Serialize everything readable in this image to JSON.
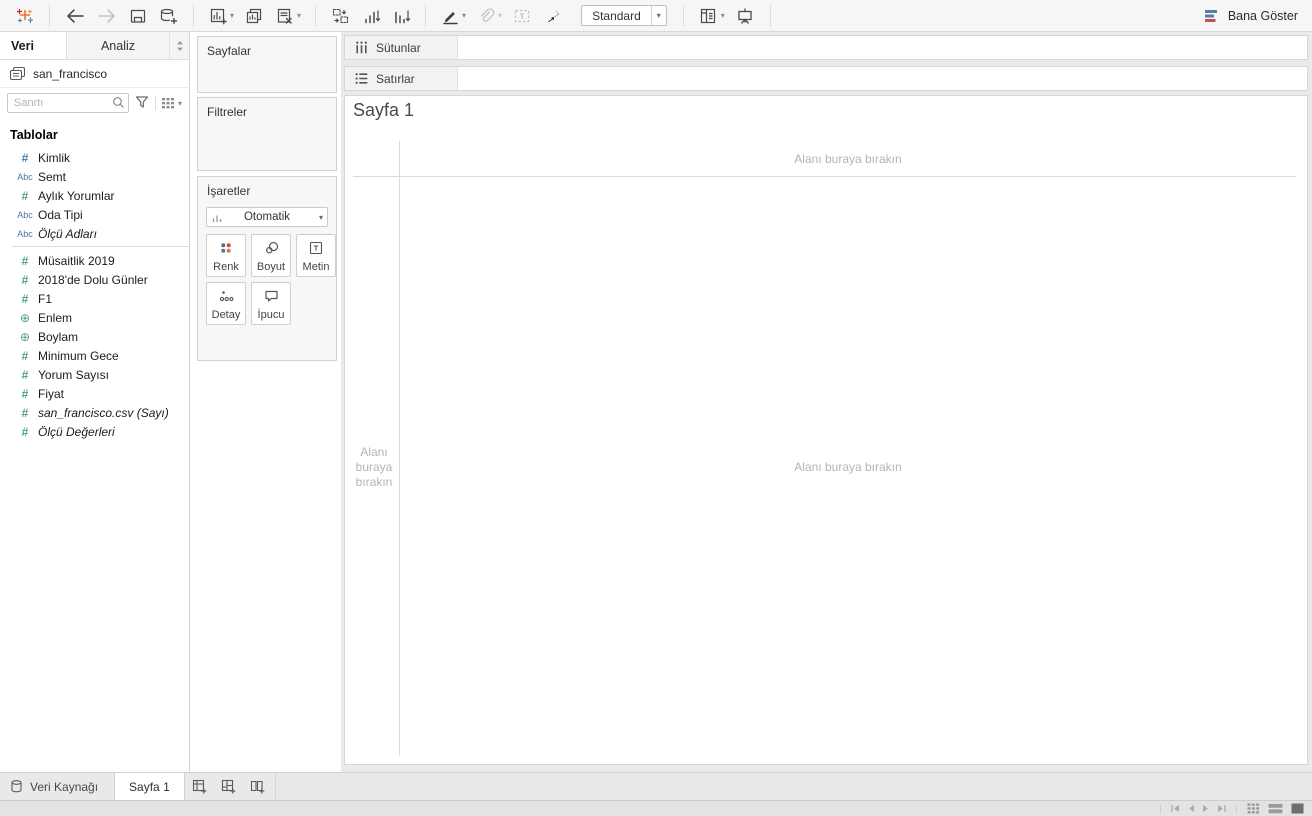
{
  "toolbar": {
    "view_mode": "Standard",
    "show_me": "Bana Göster"
  },
  "sidebar": {
    "tabs": {
      "data": "Veri",
      "analytics": "Analiz"
    },
    "data_source": "san_francisco",
    "search_placeholder": "Sanrtı",
    "section_title": "Tablolar",
    "fields": [
      {
        "label": "Kimlik",
        "icon": "hash",
        "color": "blue"
      },
      {
        "label": "Semt",
        "icon": "abc",
        "color": "blue"
      },
      {
        "label": "Aylık Yorumlar",
        "icon": "hash",
        "color": "green"
      },
      {
        "label": "Oda Tipi",
        "icon": "abc",
        "color": "blue"
      },
      {
        "label": "Ölçü Adları",
        "icon": "abc",
        "color": "blue",
        "italic": true
      },
      {
        "label": "Müsaitlik 2019",
        "icon": "hash",
        "color": "green"
      },
      {
        "label": "2018'de Dolu Günler",
        "icon": "hash",
        "color": "green"
      },
      {
        "label": "F1",
        "icon": "hash",
        "color": "green"
      },
      {
        "label": "Enlem",
        "icon": "globe",
        "color": "green"
      },
      {
        "label": "Boylam",
        "icon": "globe",
        "color": "green"
      },
      {
        "label": "Minimum Gece",
        "icon": "hash",
        "color": "green"
      },
      {
        "label": "Yorum Sayısı",
        "icon": "hash",
        "color": "green"
      },
      {
        "label": "Fiyat",
        "icon": "hash",
        "color": "green"
      },
      {
        "label": "san_francisco.csv (Sayı)",
        "icon": "hash",
        "color": "green",
        "italic": true
      },
      {
        "label": "Ölçü Değerleri",
        "icon": "hash",
        "color": "green",
        "italic": true
      }
    ]
  },
  "cards": {
    "pages": "Sayfalar",
    "filters": "Filtreler",
    "marks": "İşaretler",
    "mark_type": "Otomatik",
    "buttons": [
      {
        "label": "Renk"
      },
      {
        "label": "Boyut"
      },
      {
        "label": "Metin"
      },
      {
        "label": "Detay"
      },
      {
        "label": "İpucu"
      }
    ]
  },
  "shelves": {
    "columns": "Sütunlar",
    "rows": "Satırlar"
  },
  "canvas": {
    "sheet_title": "Sayfa 1",
    "drop_hint": "Alanı buraya bırakın"
  },
  "tabs_bar": {
    "data_source": "Veri Kaynağı",
    "sheet": "Sayfa 1"
  },
  "colors": {
    "dimension_blue": "#4a79a8",
    "measure_green": "#4f9e87",
    "show_me_blue": "#5b7aa5",
    "show_me_red": "#c0504d",
    "renk_dots": [
      "#6b6b6b",
      "#cc4b4b",
      "#4c78a8",
      "#c58058"
    ]
  },
  "icons": {
    "tableau-logo": "✳",
    "back": "←",
    "forward": "→",
    "save": "▣",
    "add-data-source": "⛁+",
    "new-worksheet": "▤+",
    "duplicate": "⧉",
    "clear-sheet": "▢×",
    "swap-axes": "⇄",
    "sort-ascending": "↥",
    "sort-descending": "↧",
    "highlight": "✎",
    "group": "🖇",
    "show-mark-labels": "[T]",
    "pin": "📌",
    "show-hide-cards": "▦",
    "presentation-mode": "🖵",
    "search": "⌕",
    "filter-funnel": "▽",
    "pane-view-grid": "▦",
    "sort-fields": "↕",
    "hash": "#",
    "abc": "Abc",
    "globe": "⊕",
    "columns-shelf": "⫴",
    "rows-shelf": "≡",
    "database": "⛁",
    "nav-first": "⏮",
    "nav-prev": "◂",
    "nav-next": "▸",
    "nav-last": "⏭",
    "grid-view": "▦",
    "filmstrip-view": "▤",
    "current-view": "■"
  }
}
